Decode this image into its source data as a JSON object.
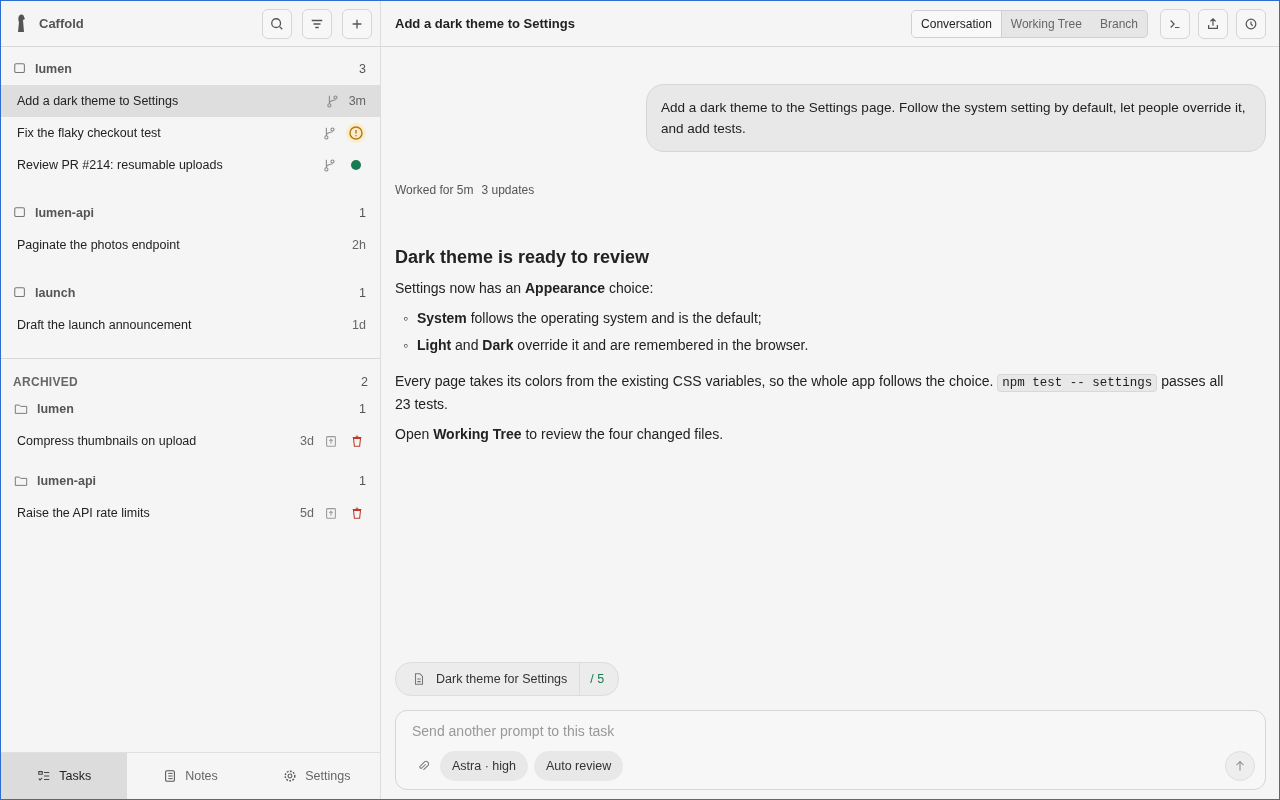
{
  "app": {
    "name": "Caffold"
  },
  "groups": [
    {
      "name": "lumen",
      "count": "3",
      "tasks": [
        {
          "title": "Add a dark theme to Settings",
          "selected": true,
          "branch": true,
          "kind": "time",
          "time": "3m"
        },
        {
          "title": "Fix the flaky checkout test",
          "selected": false,
          "branch": true,
          "kind": "warning"
        },
        {
          "title": "Review PR #214: resumable uploads",
          "selected": false,
          "branch": true,
          "kind": "dot",
          "color": "#1a7a52"
        }
      ]
    },
    {
      "name": "lumen-api",
      "count": "1",
      "tasks": [
        {
          "title": "Paginate the photos endpoint",
          "selected": false,
          "branch": false,
          "kind": "time",
          "time": "2h"
        }
      ]
    },
    {
      "name": "launch",
      "count": "1",
      "tasks": [
        {
          "title": "Draft the launch announcement",
          "selected": false,
          "branch": false,
          "kind": "time",
          "time": "1d"
        }
      ]
    }
  ],
  "archived": {
    "label": "ARCHIVED",
    "count": "2",
    "groups": [
      {
        "name": "lumen",
        "count": "1",
        "tasks": [
          {
            "title": "Compress thumbnails on upload",
            "time": "3d"
          }
        ]
      },
      {
        "name": "lumen-api",
        "count": "1",
        "tasks": [
          {
            "title": "Raise the API rate limits",
            "time": "5d"
          }
        ]
      }
    ]
  },
  "bottom_tabs": [
    {
      "label": "Tasks",
      "selected": true,
      "kind": "tasks"
    },
    {
      "label": "Notes",
      "selected": false,
      "kind": "notes"
    },
    {
      "label": "Settings",
      "selected": false,
      "kind": "settings"
    }
  ],
  "header": {
    "title": "Add a dark theme to Settings",
    "views": [
      {
        "label": "Conversation",
        "selected": true
      },
      {
        "label": "Working Tree",
        "selected": false
      },
      {
        "label": "Branch",
        "selected": false
      }
    ]
  },
  "user_message": "Add a dark theme to the Settings page. Follow the system setting by default, let people override it, and add tests.",
  "worked": {
    "time": "Worked for 5m",
    "updates": "3 updates"
  },
  "reply": {
    "heading": "Dark theme is ready to review",
    "blocks": [
      {
        "kind": "paragraph",
        "text": "Settings now has an **Appearance** choice:"
      },
      {
        "kind": "list",
        "marker": "◦",
        "items": [
          "**System** follows the operating system and is the default;",
          "**Light** and **Dark** override it and are remembered in the browser."
        ]
      },
      {
        "kind": "code_paragraph",
        "before": "Every page takes its colors from the existing CSS variables, so the whole app follows the choice.",
        "code": "npm test -- settings",
        "after": "passes all 23 tests."
      },
      {
        "kind": "paragraph",
        "text": "Open **Working Tree** to review the four changed files."
      }
    ]
  },
  "plan": {
    "title": "Dark theme for Settings",
    "progress": "/ 5",
    "active": true
  },
  "composer": {
    "placeholder": "Send another prompt to this task",
    "model": "Astra · high",
    "review": "Auto review"
  }
}
